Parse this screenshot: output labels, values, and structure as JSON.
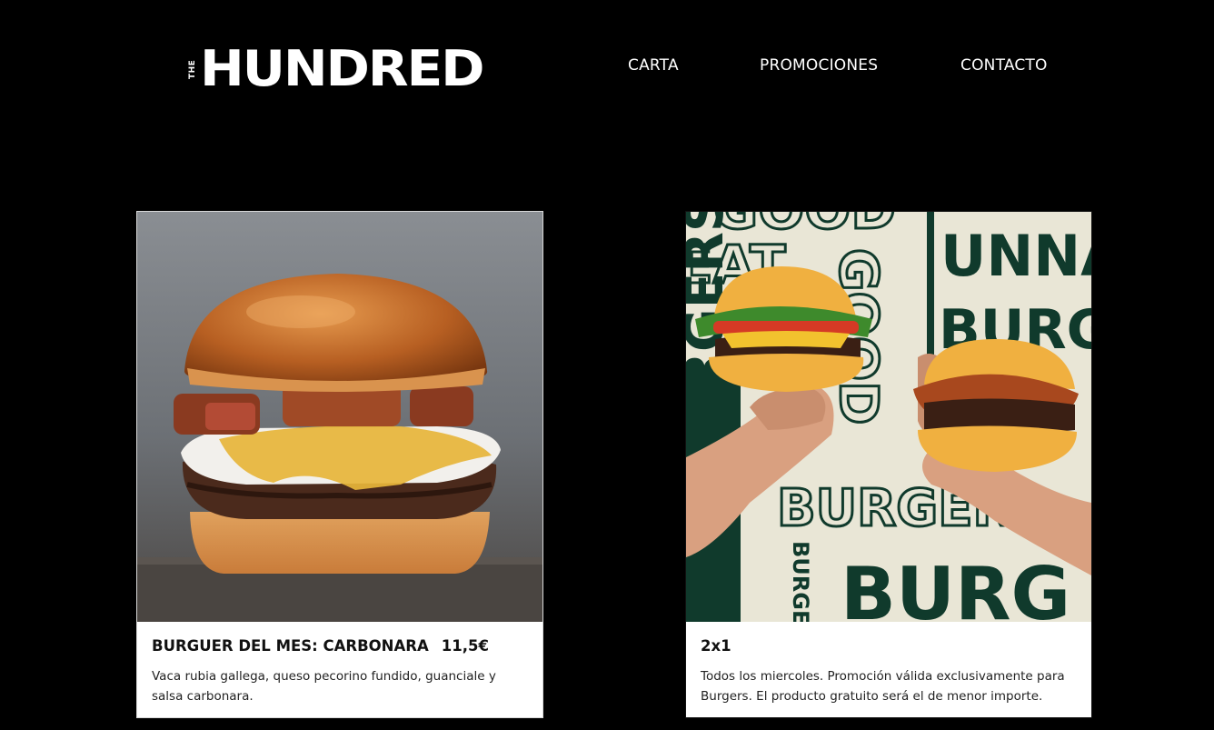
{
  "header": {
    "logo": {
      "small": "THE",
      "main": "HUNDRED"
    },
    "nav": [
      {
        "label": "CARTA"
      },
      {
        "label": "PROMOCIONES"
      },
      {
        "label": "CONTACTO"
      }
    ]
  },
  "promotions": [
    {
      "image": "burger-photo",
      "title": "BURGUER DEL MES: CARBONARA",
      "price": "11,5€",
      "description": "Vaca rubia gallega, queso pecorino fundido, guanciale y salsa carbonara."
    },
    {
      "image": "two-burgers-promo-photo",
      "title": "2x1",
      "price": "",
      "description": "Todos los miercoles. Promoción válida exclusivamente para Burgers. El producto gratuito será el de menor importe.",
      "image_text": [
        "GOOD",
        "EAT",
        "GOOD",
        "UNNAL",
        "BURGER",
        "BURGERS",
        "BURGERS",
        "BURGER",
        "BURG"
      ]
    }
  ],
  "colors": {
    "background": "#000000",
    "card": "#ffffff",
    "poster_green": "#103a2c",
    "poster_cream": "#e9e6d6"
  }
}
